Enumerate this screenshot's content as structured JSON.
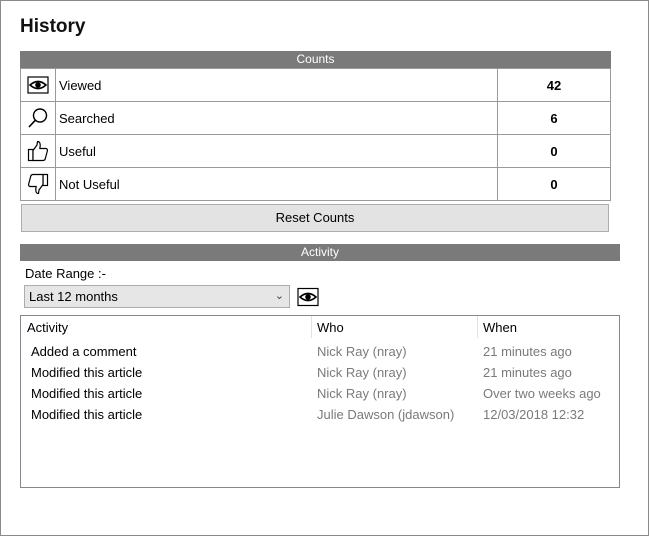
{
  "title": "History",
  "counts": {
    "header": "Counts",
    "rows": [
      {
        "icon": "eye-icon",
        "label": "Viewed",
        "value": "42"
      },
      {
        "icon": "magnifier-icon",
        "label": "Searched",
        "value": "6"
      },
      {
        "icon": "thumbs-up-icon",
        "label": "Useful",
        "value": "0"
      },
      {
        "icon": "thumbs-down-icon",
        "label": "Not Useful",
        "value": "0"
      }
    ],
    "reset_label": "Reset Counts"
  },
  "activity": {
    "header": "Activity",
    "date_range_label": "Date Range :-",
    "date_range_value": "Last 12 months",
    "columns": [
      "Activity",
      "Who",
      "When"
    ],
    "rows": [
      {
        "activity": "Added a comment",
        "who": "Nick Ray (nray)",
        "when": "21 minutes ago"
      },
      {
        "activity": "Modified this article",
        "who": "Nick Ray (nray)",
        "when": "21 minutes ago"
      },
      {
        "activity": "Modified this article",
        "who": "Nick Ray (nray)",
        "when": "Over two weeks ago"
      },
      {
        "activity": "Modified this article",
        "who": "Julie Dawson (jdawson)",
        "when": "12/03/2018 12:32"
      }
    ]
  }
}
